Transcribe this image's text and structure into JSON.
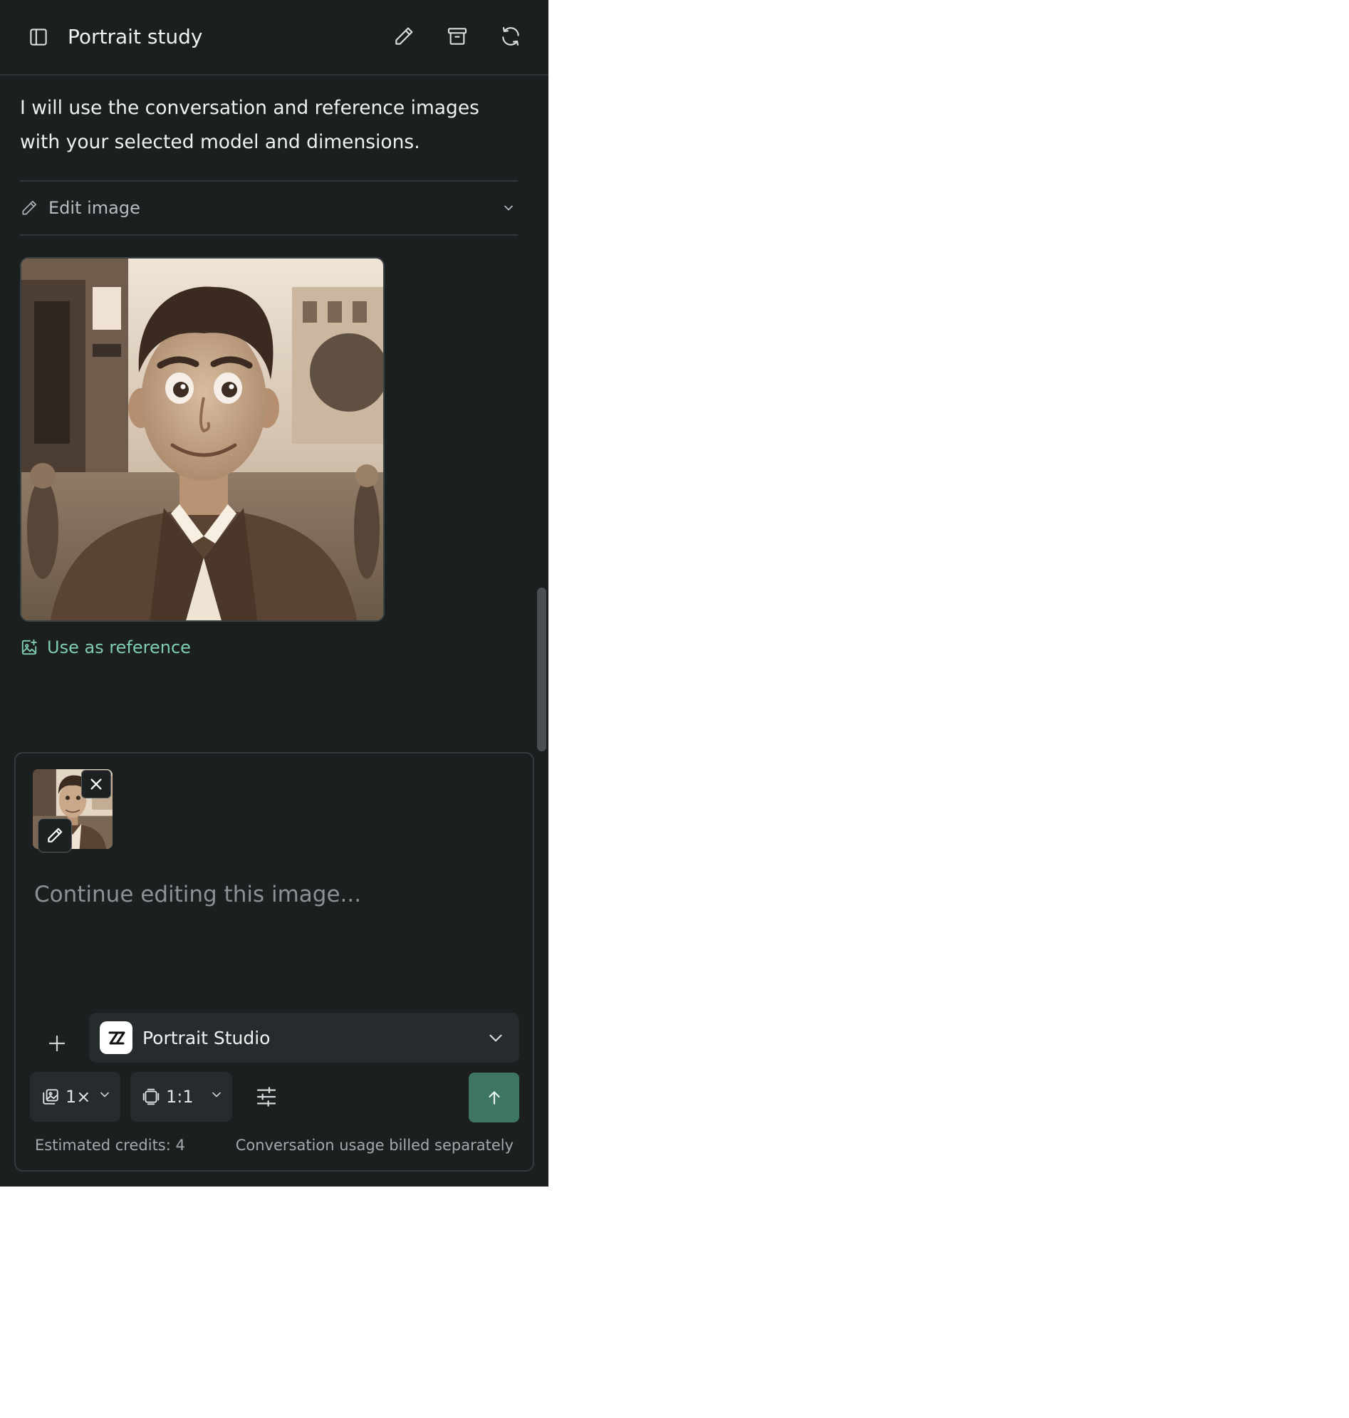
{
  "header": {
    "title": "Portrait study"
  },
  "message": {
    "text": "I will use the conversation and reference images with your selected model and dimensions."
  },
  "edit_section": {
    "label": "Edit image"
  },
  "actions": {
    "use_as_reference": "Use as reference"
  },
  "composer": {
    "placeholder": "Continue editing this image...",
    "model_name": "Portrait Studio",
    "count_label": "1×",
    "ratio_label": "1:1",
    "estimated_credits": "Estimated credits: 4",
    "usage_note": "Conversation usage billed separately"
  },
  "colors": {
    "panel_bg": "#1b1f20",
    "accent_green": "#7fcfae",
    "send_button": "#3e7563"
  }
}
